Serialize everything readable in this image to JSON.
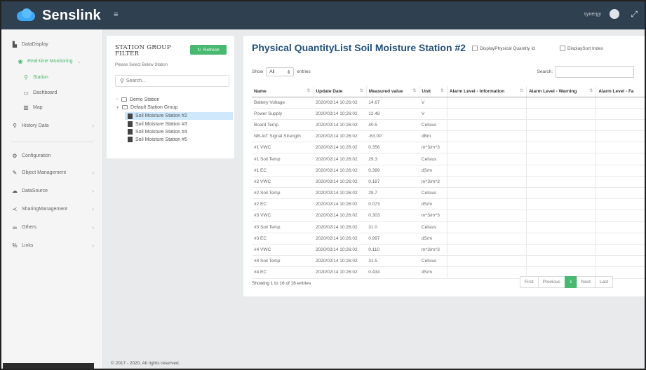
{
  "brand": {
    "name": "Senslink"
  },
  "topbar": {
    "menu_icon": "hamburger-icon",
    "user": "synergy",
    "globe_icon": "globe-icon",
    "expand_icon": "expand-icon"
  },
  "sidebar": {
    "items": [
      {
        "label": "DataDisplay",
        "icon": "chart-icon"
      },
      {
        "label": "Real-time Monitoring",
        "icon": "monitor-icon"
      },
      {
        "label": "Station",
        "icon": "pin-icon"
      },
      {
        "label": "Dashboard",
        "icon": "dashboard-icon"
      },
      {
        "label": "Map",
        "icon": "map-icon"
      },
      {
        "label": "History Data",
        "icon": "search-icon"
      },
      {
        "label": "Configuration",
        "icon": "gears-icon"
      },
      {
        "label": "Object Management",
        "icon": "wrench-icon"
      },
      {
        "label": "DataSource",
        "icon": "cloud-icon"
      },
      {
        "label": "SharingManagement",
        "icon": "share-icon"
      },
      {
        "label": "Others",
        "icon": "sliders-icon"
      },
      {
        "label": "Links",
        "icon": "link-icon"
      }
    ]
  },
  "filter": {
    "title_line1": "STATION GROUP",
    "title_line2": "FILTER",
    "refresh_label": "Refresh",
    "hint": "Please Select Below Station",
    "search_placeholder": "Search...",
    "tree": {
      "demo": "Demo Station",
      "default": "Default Station Group",
      "stations": [
        "Soil Moisture Station #2",
        "Soil Moisture Station #3",
        "Soil Moisture Station #4",
        "Soil Moisture Station #5"
      ]
    }
  },
  "main": {
    "title": "Physical QuantityList  Soil Moisture Station #2",
    "display_id_label": "DisplayPhysical Quantity Id",
    "display_sort_label": "DisplaySort Index",
    "show_label": "Show",
    "show_value": "All",
    "entries_label": "entries",
    "search_label": "Search:",
    "columns": [
      "Name",
      "Update Date",
      "Measured value",
      "Unit",
      "Alarm Level - Information",
      "Alarm Level - Warning",
      "Alarm Level - Fa"
    ],
    "rows": [
      [
        "Battery Voltage",
        "2020/02/14 10:26:02",
        "14.67",
        "V"
      ],
      [
        "Power Supply",
        "2020/02/14 10:26:02",
        "12.48",
        "V"
      ],
      [
        "Board Temp",
        "2020/02/14 10:26:02",
        "40.5",
        "Celsius"
      ],
      [
        "NB-IoT Signal Strength",
        "2020/02/14 10:26:02",
        "-63.00",
        "dBm"
      ],
      [
        "#1 VWC",
        "2020/02/14 10:26:02",
        "0.356",
        "m^3/m^3"
      ],
      [
        "#1 Soil Temp",
        "2020/02/14 10:26:02",
        "29.3",
        "Celsius"
      ],
      [
        "#1 EC",
        "2020/02/14 10:26:02",
        "0.399",
        "dS/m"
      ],
      [
        "#2 VWC",
        "2020/02/14 10:26:02",
        "0.187",
        "m^3/m^3"
      ],
      [
        "#2 Soil Temp",
        "2020/02/14 10:26:02",
        "29.7",
        "Celsius"
      ],
      [
        "#2 EC",
        "2020/02/14 10:26:02",
        "0.073",
        "dS/m"
      ],
      [
        "#3 VWC",
        "2020/02/14 10:26:02",
        "0.303",
        "m^3/m^3"
      ],
      [
        "#3 Soil Temp",
        "2020/02/14 10:26:02",
        "31.0",
        "Celsius"
      ],
      [
        "#3 EC",
        "2020/02/14 10:26:02",
        "0.997",
        "dS/m"
      ],
      [
        "#4 VWC",
        "2020/02/14 10:26:02",
        "0.110",
        "m^3/m^3"
      ],
      [
        "#4 Soil Temp",
        "2020/02/14 10:26:02",
        "31.5",
        "Celsius"
      ],
      [
        "#4 EC",
        "2020/02/14 10:26:02",
        "0.434",
        "dS/m"
      ]
    ],
    "info": "Showing 1 to 16 of 16 entries",
    "pager": {
      "first": "First",
      "previous": "Previous",
      "current": "1",
      "next": "Next",
      "last": "Last"
    }
  },
  "footer": {
    "copyright": "© 2017 - 2020. All rights reserved."
  },
  "colors": {
    "topbar": "#2f4050",
    "accent_green": "#49b870",
    "title_blue": "#23527c",
    "selected_row": "#cfe8fb"
  }
}
